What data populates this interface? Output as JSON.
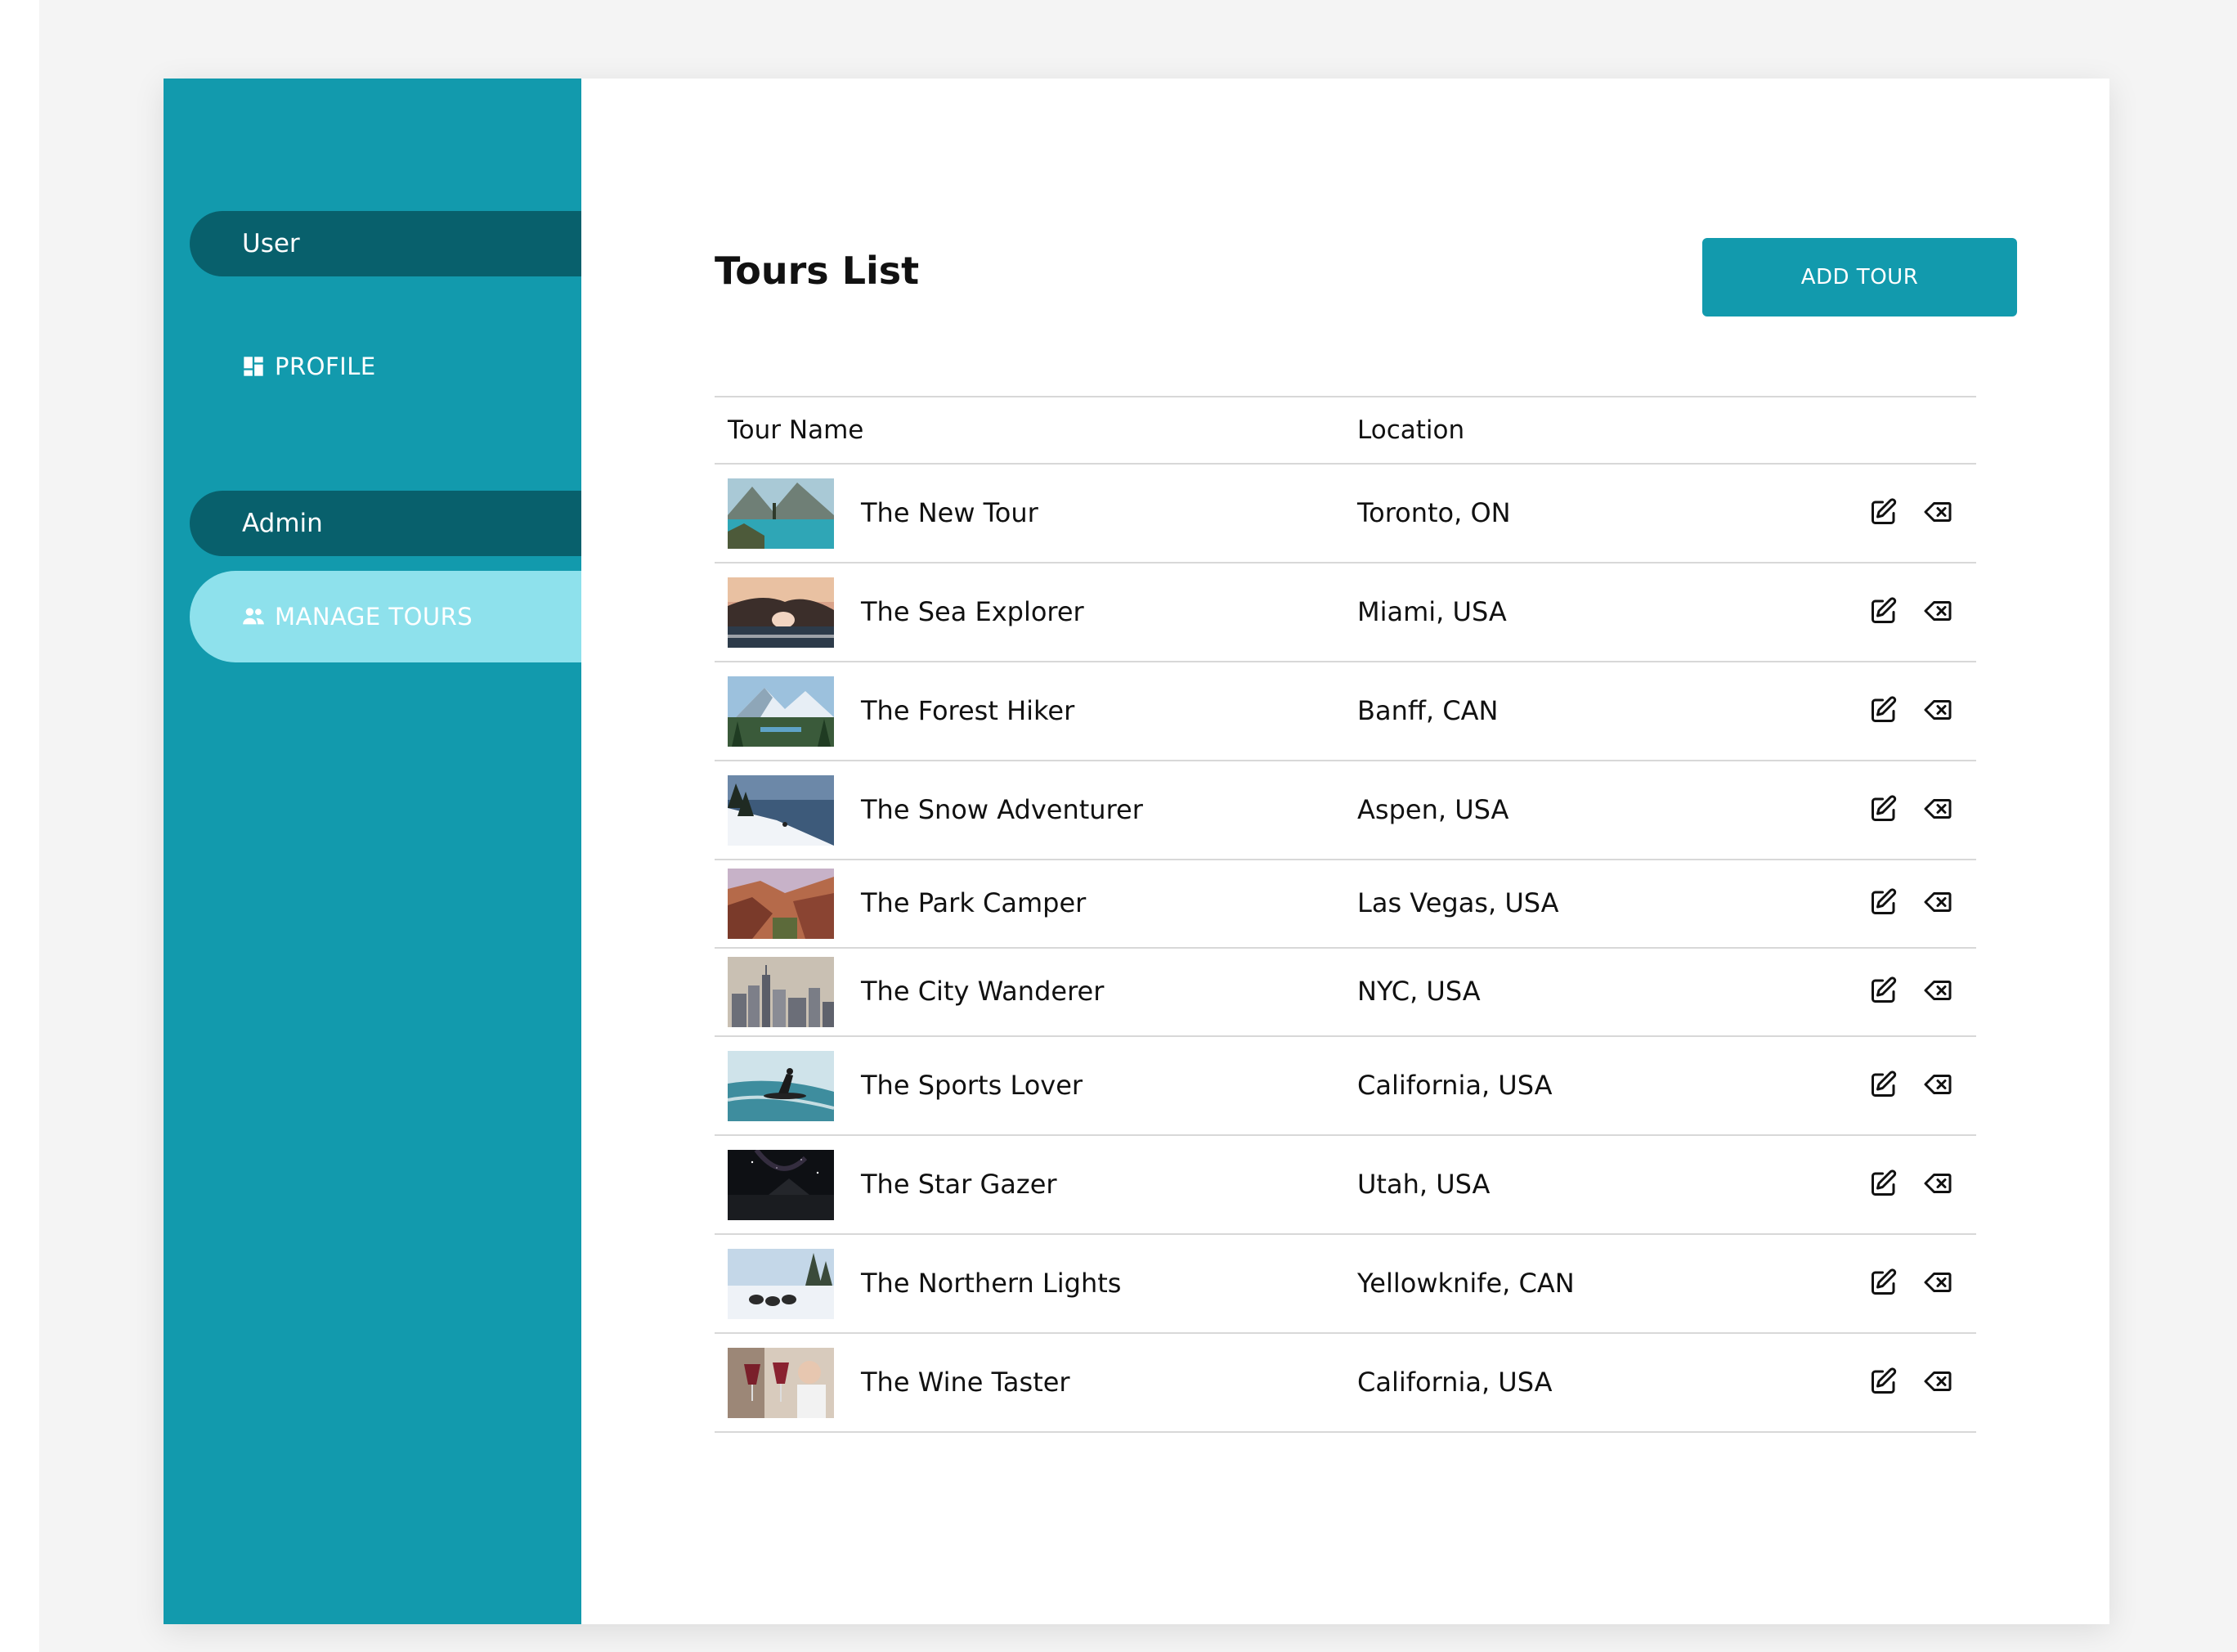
{
  "sidebar": {
    "user_label": "User",
    "profile_label": "PROFILE",
    "admin_label": "Admin",
    "manage_label": "MANAGE TOURS"
  },
  "header": {
    "title": "Tours List",
    "add_button": "ADD TOUR"
  },
  "table": {
    "columns": [
      "Tour Name",
      "Location"
    ],
    "rows": [
      {
        "name": "The New Tour",
        "location": "Toronto, ON",
        "thumb": "lake-icon"
      },
      {
        "name": "The Sea Explorer",
        "location": "Miami, USA",
        "thumb": "sea-arch-icon"
      },
      {
        "name": "The Forest Hiker",
        "location": "Banff, CAN",
        "thumb": "mountain-forest-icon"
      },
      {
        "name": "The Snow Adventurer",
        "location": "Aspen, USA",
        "thumb": "snow-slope-icon"
      },
      {
        "name": "The Park Camper",
        "location": "Las Vegas, USA",
        "thumb": "canyon-icon"
      },
      {
        "name": "The City Wanderer",
        "location": "NYC, USA",
        "thumb": "city-skyline-icon"
      },
      {
        "name": "The Sports Lover",
        "location": "California, USA",
        "thumb": "surfer-icon"
      },
      {
        "name": "The Star Gazer",
        "location": "Utah, USA",
        "thumb": "night-sky-icon"
      },
      {
        "name": "The Northern Lights",
        "location": "Yellowknife, CAN",
        "thumb": "dog-sled-icon"
      },
      {
        "name": "The Wine Taster",
        "location": "California, USA",
        "thumb": "wine-glasses-icon"
      }
    ]
  },
  "colors": {
    "sidebar": "#129aad",
    "pill": "#08606c",
    "active_nav": "#8ee1ec",
    "button": "#129aad"
  }
}
